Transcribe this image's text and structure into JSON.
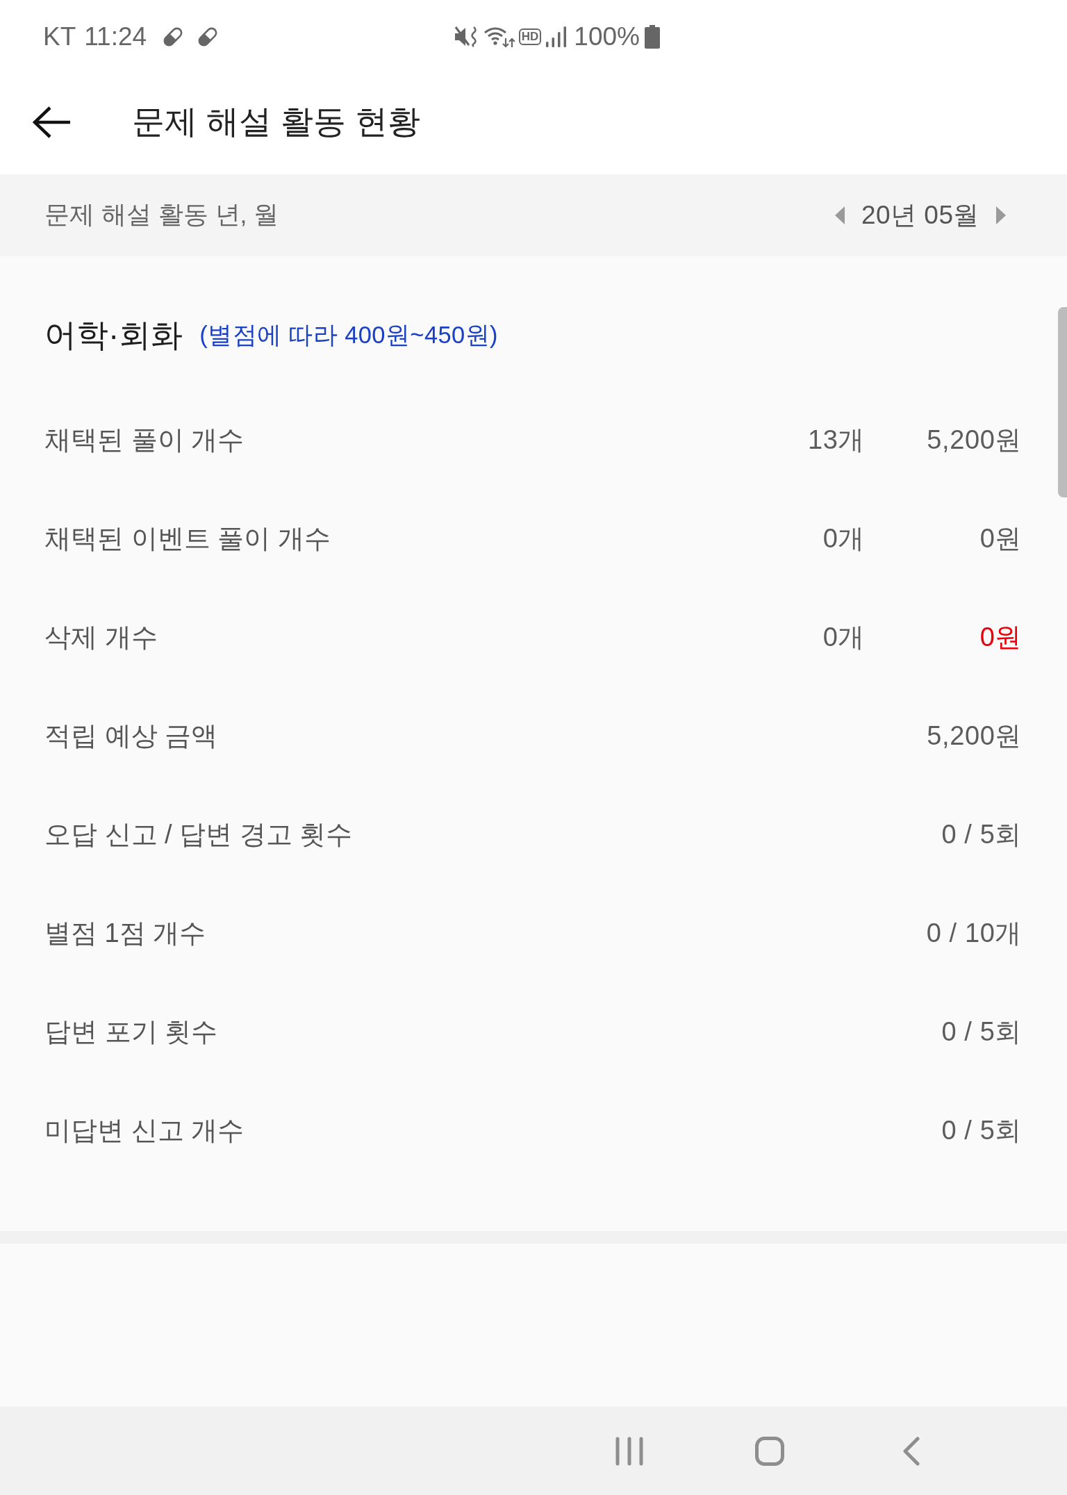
{
  "status_bar": {
    "carrier": "KT",
    "time": "11:24",
    "hd_badge": "HD",
    "battery": "100%"
  },
  "header": {
    "title": "문제 해설 활동 현황"
  },
  "period": {
    "label": "문제 해설 활동 년, 월",
    "value": "20년 05월"
  },
  "section": {
    "title": "어학·회화",
    "note": "(별점에 따라 400원~450원)",
    "rows": [
      {
        "label": "채택된 풀이 개수",
        "count": "13개",
        "amount": "5,200원",
        "deduction": false
      },
      {
        "label": "채택된 이벤트 풀이 개수",
        "count": "0개",
        "amount": "0원",
        "deduction": false
      },
      {
        "label": "삭제 개수",
        "count": "0개",
        "amount": "0원",
        "deduction": true
      },
      {
        "label": "적립 예상 금액",
        "amount": "5,200원",
        "deduction": false
      },
      {
        "label": "오답 신고 / 답변 경고 횟수",
        "amount": "0 / 5회",
        "deduction": false
      },
      {
        "label": "별점 1점 개수",
        "amount": "0 / 10개",
        "deduction": false
      },
      {
        "label": "답변 포기 횟수",
        "amount": "0 / 5회",
        "deduction": false
      },
      {
        "label": "미답변 신고 개수",
        "amount": "0 / 5회",
        "deduction": false
      }
    ]
  }
}
